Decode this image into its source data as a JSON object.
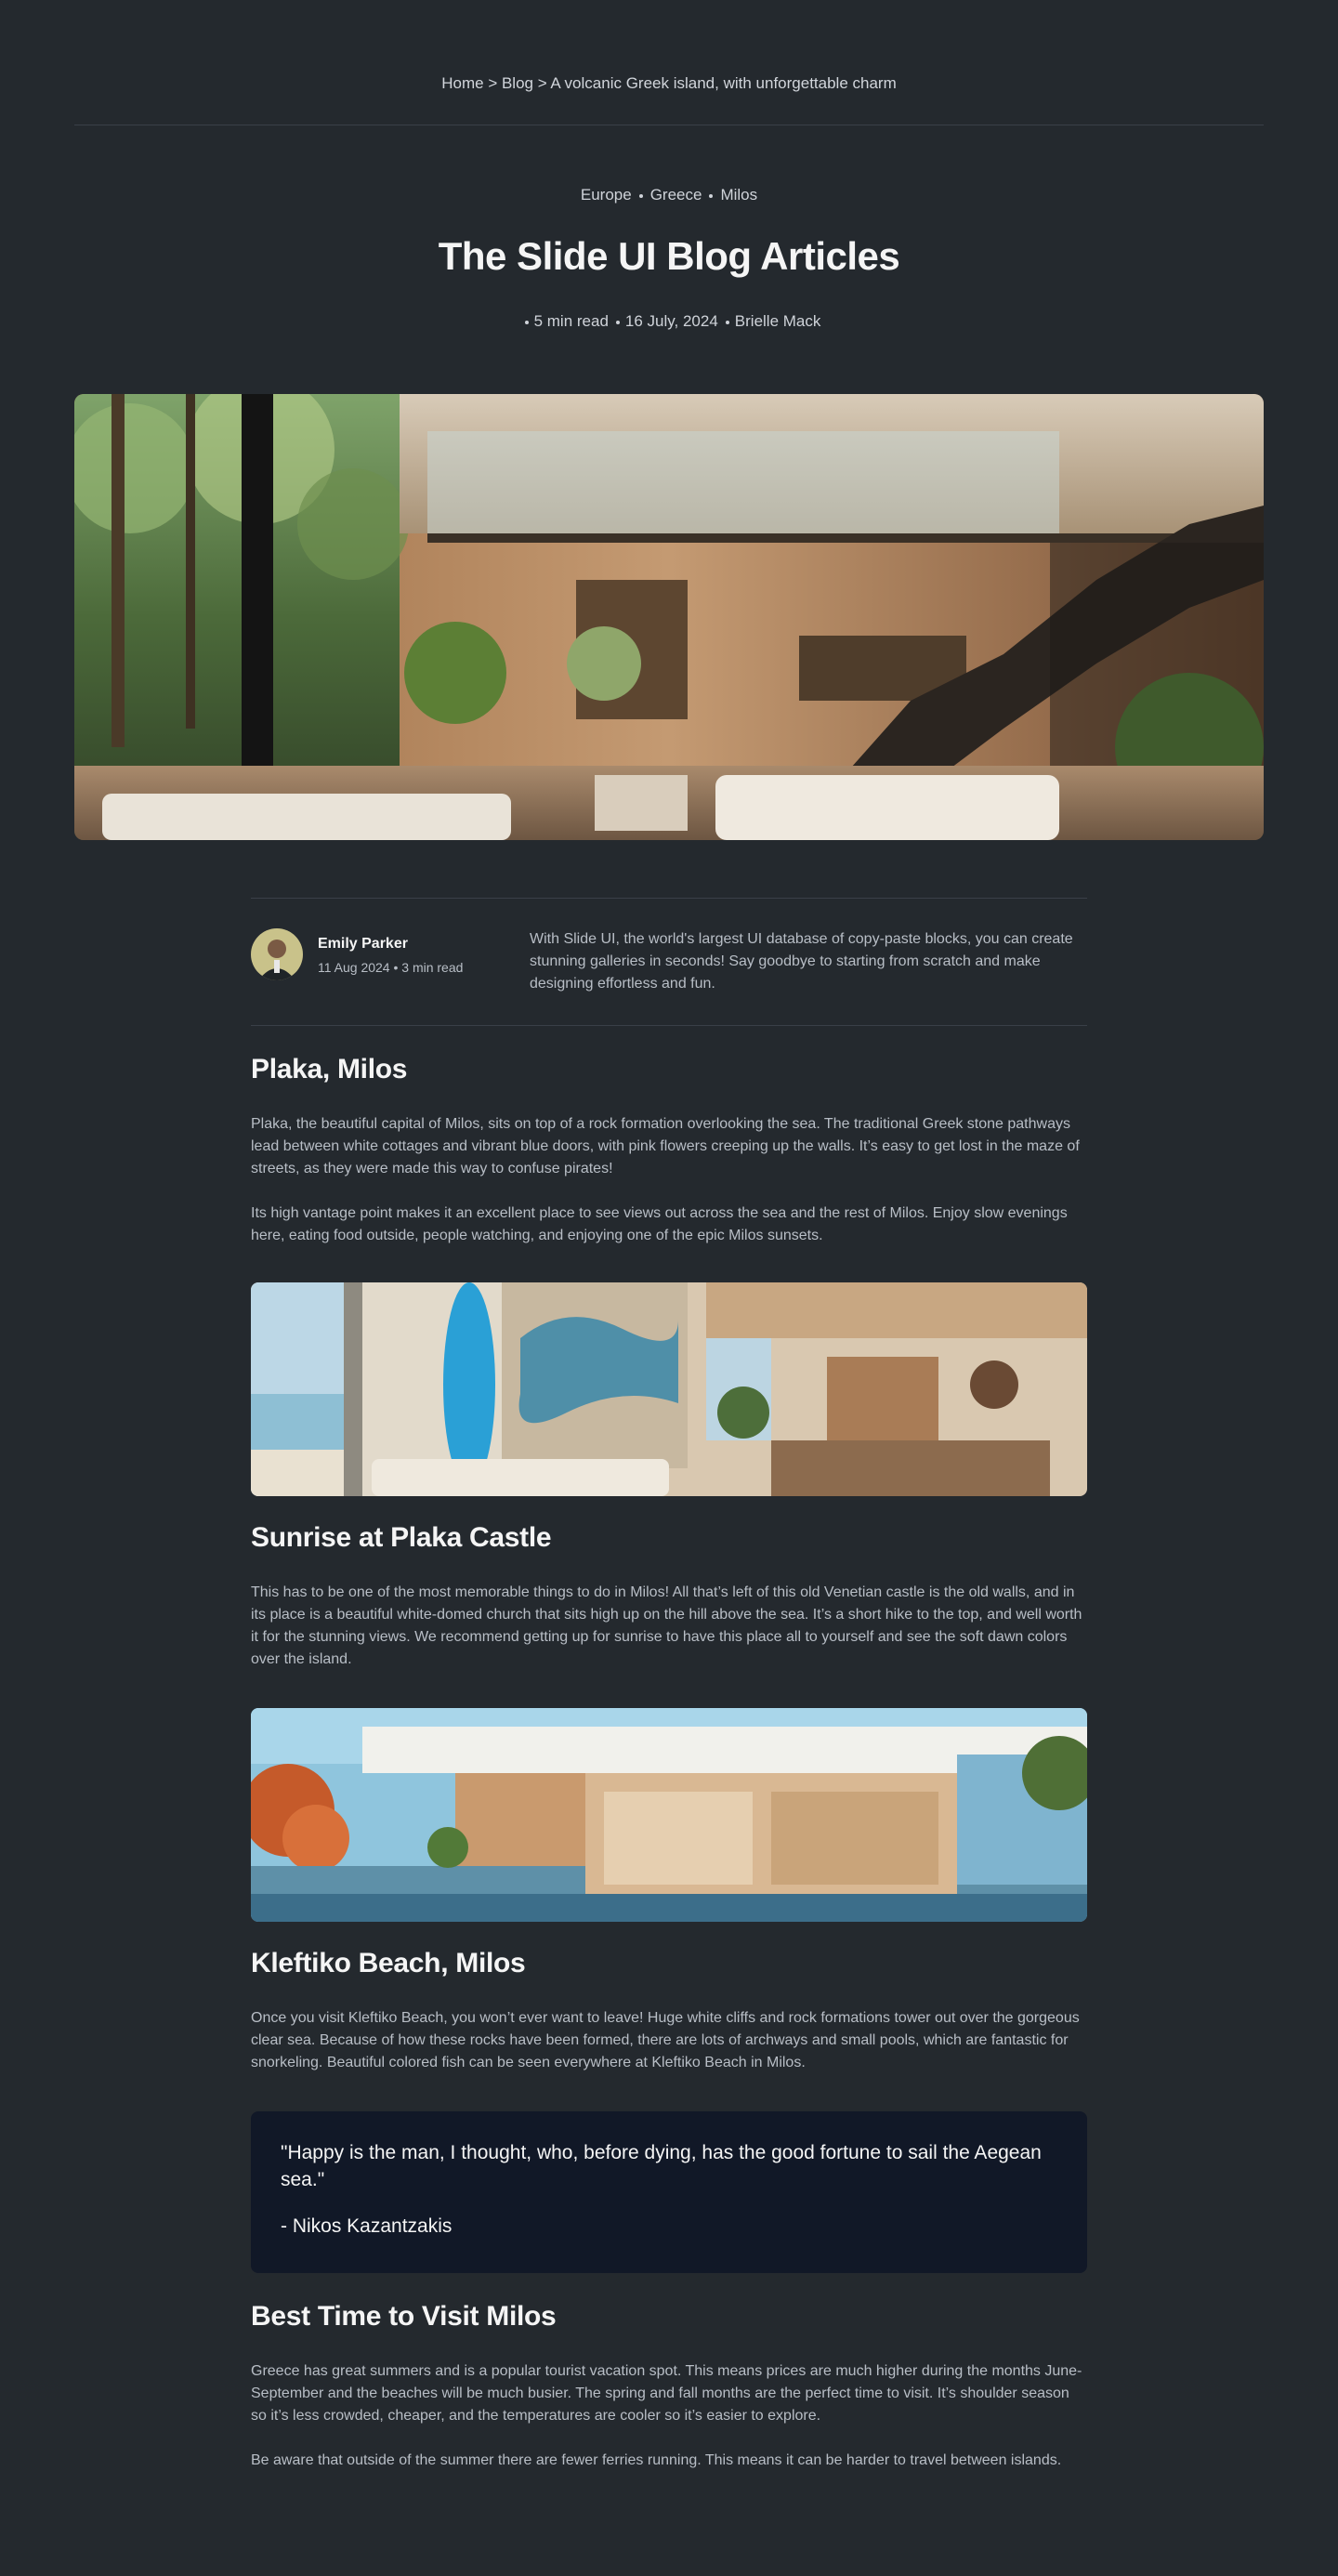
{
  "breadcrumb": "Home > Blog > A volcanic Greek island, with unforgettable charm",
  "tags": [
    "Europe",
    "Greece",
    "Milos"
  ],
  "title": "The Slide UI Blog Articles",
  "meta": {
    "read_time": "5 min read",
    "date": "16 July, 2024",
    "author": "Brielle Mack"
  },
  "author_card": {
    "name": "Emily Parker",
    "meta": "11 Aug 2024 • 3 min read",
    "description": "With Slide UI, the world's largest UI database of copy-paste blocks, you can create stunning galleries in seconds! Say goodbye to starting from scratch and make designing effortless and fun."
  },
  "sections": {
    "plaka": {
      "heading": "Plaka, Milos",
      "p1": "Plaka, the beautiful capital of Milos, sits on top of a rock formation overlooking the sea. The traditional Greek stone pathways lead between white cottages and vibrant blue doors, with pink flowers creeping up the walls. It’s easy to get lost in the maze of streets, as they were made this way to confuse pirates!",
      "p2": "Its high vantage point makes it an excellent place to see views out across the sea and the rest of Milos. Enjoy slow evenings here, eating food outside, people watching, and enjoying one of the epic Milos sunsets."
    },
    "sunrise": {
      "heading": "Sunrise at Plaka Castle",
      "p1": "This has to be one of the most memorable things to do in Milos! All that’s left of this old Venetian castle is the old walls, and in its place is a beautiful white-domed church that sits high up on the hill above the sea. It’s a short hike to the top, and well worth it for the stunning views. We recommend getting up for sunrise to have this place all to yourself and see the soft dawn colors over the island."
    },
    "kleftiko": {
      "heading": "Kleftiko Beach, Milos",
      "p1": "Once you visit Kleftiko Beach, you won’t ever want to leave! Huge white cliffs and rock formations tower out over the gorgeous clear sea. Because of how these rocks have been formed, there are lots of archways and small pools, which are fantastic for snorkeling. Beautiful colored fish can be seen everywhere at Kleftiko Beach in Milos."
    },
    "quote": {
      "text": "\"Happy is the man, I thought, who, before dying, has the good fortune to sail the Aegean sea.\"",
      "author": "- Nikos Kazantzakis"
    },
    "best_time": {
      "heading": "Best Time to Visit Milos",
      "p1": "Greece has great summers and is a popular tourist vacation spot. This means prices are much higher during the months June-September and the beaches will be much busier. The spring and fall months are the perfect time to visit. It’s shoulder season so it’s less crowded, cheaper, and the temperatures are cooler so it’s easier to explore.",
      "p2": "Be aware that outside of the summer there are fewer ferries running. This means it can be harder to travel between islands."
    }
  },
  "colors": {
    "background": "#24292e",
    "quote_bg": "#111827",
    "text_muted": "#b8bec6"
  }
}
